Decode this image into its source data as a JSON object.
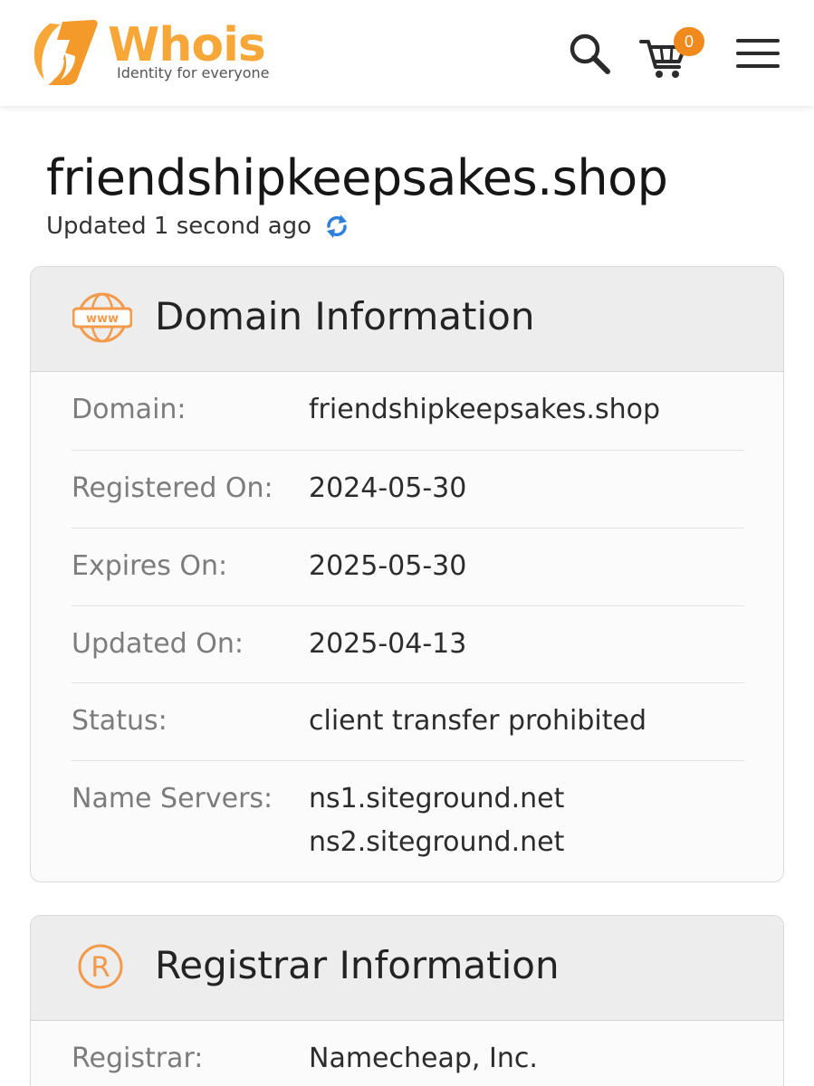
{
  "header": {
    "logo_word": "Whois",
    "logo_tagline": "Identity for everyone",
    "cart_count": "0",
    "icons": [
      "search-icon",
      "cart-icon",
      "hamburger-menu-icon"
    ],
    "colors": {
      "brand_orange": "#f7a738",
      "badge_orange": "#f08a1c",
      "refresh_blue": "#2f80d9"
    }
  },
  "page": {
    "title": "friendshipkeepsakes.shop",
    "updated": "Updated 1 second ago"
  },
  "domain_info": {
    "title": "Domain Information",
    "icon": "www-globe-icon",
    "rows": [
      {
        "label": "Domain:",
        "value": "friendshipkeepsakes.shop"
      },
      {
        "label": "Registered On:",
        "value": "2024-05-30"
      },
      {
        "label": "Expires On:",
        "value": "2025-05-30"
      },
      {
        "label": "Updated On:",
        "value": "2025-04-13"
      },
      {
        "label": "Status:",
        "value": "client transfer prohibited"
      },
      {
        "label": "Name Servers:",
        "values": [
          "ns1.siteground.net",
          "ns2.siteground.net"
        ]
      }
    ]
  },
  "registrar_info": {
    "title": "Registrar Information",
    "icon": "registered-trademark-icon",
    "rows": [
      {
        "label": "Registrar:",
        "value": "Namecheap, Inc."
      }
    ]
  }
}
